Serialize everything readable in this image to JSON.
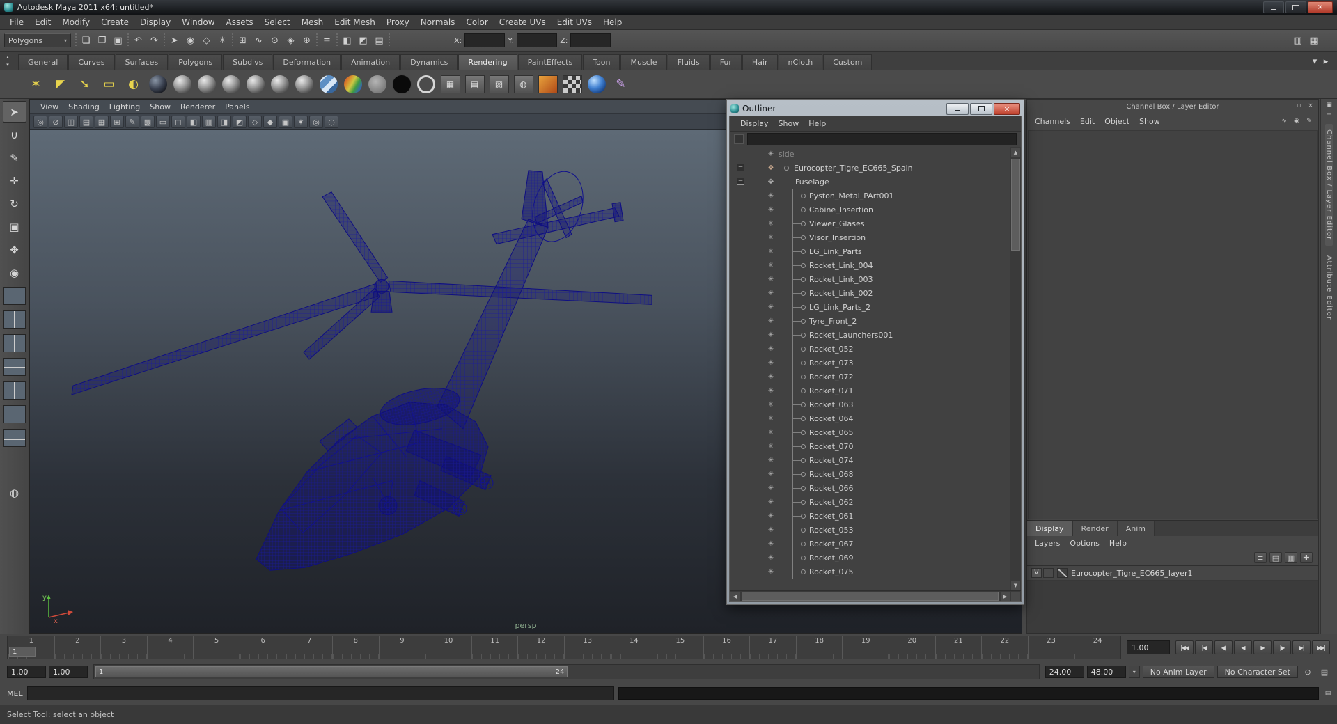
{
  "window": {
    "title": "Autodesk Maya 2011 x64: untitled*"
  },
  "menubar": {
    "items": [
      "File",
      "Edit",
      "Modify",
      "Create",
      "Display",
      "Window",
      "Assets",
      "Select",
      "Mesh",
      "Edit Mesh",
      "Proxy",
      "Normals",
      "Color",
      "Create UVs",
      "Edit UVs",
      "Help"
    ]
  },
  "statusline": {
    "mode": "Polygons",
    "x_label": "X:",
    "y_label": "Y:",
    "z_label": "Z:",
    "items": [
      {
        "name": "separator",
        "sep": true
      },
      {
        "name": "new-scene-icon",
        "glyph": "❏"
      },
      {
        "name": "open-scene-icon",
        "glyph": "❐"
      },
      {
        "name": "save-scene-icon",
        "glyph": "▣"
      },
      {
        "name": "separator",
        "sep": true
      },
      {
        "name": "undo-icon",
        "glyph": "↶"
      },
      {
        "name": "redo-icon",
        "glyph": "↷"
      },
      {
        "name": "separator",
        "sep": true
      },
      {
        "name": "select-hierarchy-icon",
        "glyph": "➤"
      },
      {
        "name": "select-object-icon",
        "glyph": "◉"
      },
      {
        "name": "select-component-icon",
        "glyph": "◇"
      },
      {
        "name": "highlight-selection-icon",
        "glyph": "✳"
      },
      {
        "name": "separator",
        "sep": true
      },
      {
        "name": "snap-to-grid-icon",
        "glyph": "⊞"
      },
      {
        "name": "snap-to-curve-icon",
        "glyph": "∿"
      },
      {
        "name": "snap-to-point-icon",
        "glyph": "⊙"
      },
      {
        "name": "snap-to-plane-icon",
        "glyph": "◈"
      },
      {
        "name": "make-live-icon",
        "glyph": "⊕"
      },
      {
        "name": "separator",
        "sep": true
      },
      {
        "name": "construction-history-icon",
        "glyph": "≡"
      },
      {
        "name": "separator",
        "sep": true
      },
      {
        "name": "render-current-frame-icon",
        "glyph": "◧"
      },
      {
        "name": "ipr-render-icon",
        "glyph": "◩"
      },
      {
        "name": "render-settings-icon",
        "glyph": "▤"
      },
      {
        "name": "separator",
        "sep": true
      }
    ],
    "right_items": [
      {
        "name": "show-channel-box-icon",
        "glyph": "▥"
      },
      {
        "name": "show-layer-editor-icon",
        "glyph": "▦"
      }
    ]
  },
  "shelf": {
    "scroll_icons": [
      {
        "name": "shelf-scroll-up-icon",
        "glyph": "▴"
      },
      {
        "name": "shelf-scroll-down-icon",
        "glyph": "▾"
      }
    ],
    "tabs": [
      {
        "label": "General"
      },
      {
        "label": "Curves"
      },
      {
        "label": "Surfaces"
      },
      {
        "label": "Polygons"
      },
      {
        "label": "Subdivs"
      },
      {
        "label": "Deformation"
      },
      {
        "label": "Animation"
      },
      {
        "label": "Dynamics"
      },
      {
        "label": "Rendering",
        "active": true
      },
      {
        "label": "PaintEffects"
      },
      {
        "label": "Toon"
      },
      {
        "label": "Muscle"
      },
      {
        "label": "Fluids"
      },
      {
        "label": "Fur"
      },
      {
        "label": "Hair"
      },
      {
        "label": "nCloth"
      },
      {
        "label": "Custom"
      }
    ],
    "tab_extra_icons": [
      {
        "name": "shelf-menu-icon",
        "glyph": "▾"
      },
      {
        "name": "shelf-editor-icon",
        "glyph": "▸"
      }
    ],
    "icons": [
      {
        "name": "point-light-icon",
        "kind": "lt",
        "glyph": "✶"
      },
      {
        "name": "spot-light-icon",
        "kind": "lt",
        "glyph": "◤"
      },
      {
        "name": "directional-light-icon",
        "kind": "lt",
        "glyph": "➘"
      },
      {
        "name": "area-light-icon",
        "kind": "lt",
        "glyph": "▭"
      },
      {
        "name": "volume-light-icon",
        "kind": "lt",
        "glyph": "◐"
      },
      {
        "name": "shaded-sphere-icon",
        "kind": "ball-dark"
      },
      {
        "name": "lambert-material-icon",
        "kind": "ball-g"
      },
      {
        "name": "blinn-material-icon",
        "kind": "ball-g"
      },
      {
        "name": "phong-material-icon",
        "kind": "ball-g"
      },
      {
        "name": "phong-e-material-icon",
        "kind": "ball-g"
      },
      {
        "name": "anisotropic-material-icon",
        "kind": "ball-g"
      },
      {
        "name": "layered-shader-icon",
        "kind": "ball-g"
      },
      {
        "name": "ramp-shader-icon",
        "kind": "ball-ramp"
      },
      {
        "name": "shading-map-icon",
        "kind": "ball-rainbow"
      },
      {
        "name": "surface-shader-icon",
        "kind": "ball-flat"
      },
      {
        "name": "use-background-icon",
        "kind": "ball-black"
      },
      {
        "name": "light-ball-icon",
        "kind": "ring"
      },
      {
        "name": "file-texture-icon",
        "kind": "sq",
        "glyph": "▦"
      },
      {
        "name": "place2d-texture-icon",
        "kind": "sq",
        "glyph": "▤"
      },
      {
        "name": "bump-map-icon",
        "kind": "sq",
        "glyph": "▨"
      },
      {
        "name": "env-ball-icon",
        "kind": "sq",
        "glyph": "◍"
      },
      {
        "name": "ramp-texture-icon",
        "kind": "sq-orange"
      },
      {
        "name": "checker-texture-icon",
        "kind": "sq-checker"
      },
      {
        "name": "ocean-shader-icon",
        "kind": "ball-ocean"
      },
      {
        "name": "paint-effects-brush-icon",
        "kind": "brush",
        "glyph": "✎"
      }
    ]
  },
  "toolbox": {
    "tools": [
      {
        "name": "select-tool-button",
        "glyph": "➤",
        "active": true
      },
      {
        "name": "lasso-select-tool-button",
        "glyph": "∪"
      },
      {
        "name": "paint-select-tool-button",
        "glyph": "✎"
      },
      {
        "name": "move-tool-button",
        "glyph": "✛"
      },
      {
        "name": "rotate-tool-button",
        "glyph": "↻"
      },
      {
        "name": "scale-tool-button",
        "glyph": "▣"
      },
      {
        "name": "universal-manipulator-button",
        "glyph": "✥"
      },
      {
        "name": "soft-modification-button",
        "glyph": "◉"
      }
    ],
    "layouts": [
      {
        "name": "layout-single-pane-button",
        "kind": "lay-1"
      },
      {
        "name": "layout-four-pane-button",
        "kind": "lay-4"
      },
      {
        "name": "layout-two-pane-side-button",
        "kind": "lay-2v"
      },
      {
        "name": "layout-two-pane-stacked-button",
        "kind": "lay-2h"
      },
      {
        "name": "layout-three-pane-button",
        "kind": "lay-3"
      },
      {
        "name": "layout-outliner-persp-button",
        "kind": "lay-o"
      },
      {
        "name": "layout-hypershade-persp-button",
        "kind": "lay-h"
      }
    ],
    "extra_tool": {
      "glyph": "◍"
    }
  },
  "viewport": {
    "menus": [
      "View",
      "Shading",
      "Lighting",
      "Show",
      "Renderer",
      "Panels"
    ],
    "toolbar_icons": [
      {
        "name": "select-camera-icon",
        "glyph": "◎"
      },
      {
        "name": "lock-camera-icon",
        "glyph": "⊘"
      },
      {
        "name": "camera-attributes-icon",
        "glyph": "◫"
      },
      {
        "name": "bookmark-icon",
        "glyph": "▤"
      },
      {
        "name": "image-plane-icon",
        "glyph": "▦"
      },
      {
        "name": "two-d-pan-zoom-icon",
        "glyph": "⊞"
      },
      {
        "name": "grease-pencil-icon",
        "glyph": "✎"
      },
      {
        "name": "grid-icon",
        "glyph": "▩"
      },
      {
        "name": "film-gate-icon",
        "glyph": "▭"
      },
      {
        "name": "resolution-gate-icon",
        "glyph": "◻"
      },
      {
        "name": "gate-mask-icon",
        "glyph": "◧"
      },
      {
        "name": "field-chart-icon",
        "glyph": "▥"
      },
      {
        "name": "safe-action-icon",
        "glyph": "◨"
      },
      {
        "name": "safe-title-icon",
        "glyph": "◩"
      },
      {
        "name": "wireframe-mode-icon",
        "glyph": "◇"
      },
      {
        "name": "shaded-mode-icon",
        "glyph": "◆"
      },
      {
        "name": "textured-mode-icon",
        "glyph": "▣"
      },
      {
        "name": "lights-mode-icon",
        "glyph": "✶"
      },
      {
        "name": "isolate-select-icon",
        "glyph": "◎"
      },
      {
        "name": "xray-icon",
        "glyph": "◌"
      }
    ],
    "camera_label": "persp",
    "axis_labels": {
      "x": "x",
      "y": "y"
    }
  },
  "outliner": {
    "title": "Outliner",
    "menus": [
      "Display",
      "Show",
      "Help"
    ],
    "side_label": "side",
    "root_label": "Eurocopter_Tigre_EC665_Spain",
    "group_label": "Fuselage",
    "expand_glyph": "−",
    "node_icon_glyph": "✳",
    "root_icon_glyph": "❖",
    "group_icon_glyph": "✥",
    "side_icon_glyph": "✳",
    "children": [
      "Pyston_Metal_PArt001",
      "Cabine_Insertion",
      "Viewer_Glases",
      "Visor_Insertion",
      "LG_Link_Parts",
      "Rocket_Link_004",
      "Rocket_Link_003",
      "Rocket_Link_002",
      "LG_Link_Parts_2",
      "Tyre_Front_2",
      "Rocket_Launchers001",
      "Rocket_052",
      "Rocket_073",
      "Rocket_072",
      "Rocket_071",
      "Rocket_063",
      "Rocket_064",
      "Rocket_065",
      "Rocket_070",
      "Rocket_074",
      "Rocket_068",
      "Rocket_066",
      "Rocket_062",
      "Rocket_061",
      "Rocket_053",
      "Rocket_067",
      "Rocket_069",
      "Rocket_075"
    ]
  },
  "channel_box": {
    "strip_title": "Channel Box / Layer Editor",
    "strip_icons": [
      {
        "name": "panel-menu-icon",
        "glyph": "▫"
      },
      {
        "name": "panel-close-icon",
        "glyph": "×"
      }
    ],
    "menus": [
      "Channels",
      "Edit",
      "Object",
      "Show"
    ],
    "menu_icons": [
      {
        "name": "channel-slider-speed-icon",
        "glyph": "∿"
      },
      {
        "name": "channel-slider-mode-icon",
        "glyph": "◉"
      },
      {
        "name": "channel-settings-icon",
        "glyph": "✎"
      }
    ],
    "layer_tabs": [
      {
        "label": "Display",
        "active": true
      },
      {
        "label": "Render"
      },
      {
        "label": "Anim"
      }
    ],
    "layer_menus": [
      "Layers",
      "Options",
      "Help"
    ],
    "layer_toolbar_icons": [
      {
        "name": "sort-layers-icon",
        "glyph": "≡"
      },
      {
        "name": "empty-layer-icon",
        "glyph": "▤"
      },
      {
        "name": "new-layer-icon",
        "glyph": "▥"
      },
      {
        "name": "new-layer-from-selected-icon",
        "glyph": "✚"
      }
    ],
    "layers": [
      {
        "visibility": "V",
        "name_label": "Eurocopter_Tigre_EC665_layer1"
      }
    ]
  },
  "side_strip": {
    "icons": [
      {
        "name": "panel-expand-icon",
        "glyph": "▣"
      },
      {
        "name": "panel-collapse-icon",
        "glyph": "─"
      }
    ],
    "tabs": [
      {
        "label": "Channel Box / Layer Editor",
        "active": true
      },
      {
        "label": "Attribute Editor"
      }
    ]
  },
  "timeline": {
    "ticks": [
      "1",
      "2",
      "3",
      "4",
      "5",
      "6",
      "7",
      "8",
      "9",
      "10",
      "11",
      "12",
      "13",
      "14",
      "15",
      "16",
      "17",
      "18",
      "19",
      "20",
      "21",
      "22",
      "23",
      "24"
    ],
    "current_frame": "1",
    "current_time": "1.00",
    "transport": [
      {
        "name": "go-to-start-button",
        "glyph": "|◀◀"
      },
      {
        "name": "step-back-frame-button",
        "glyph": "|◀"
      },
      {
        "name": "step-back-key-button",
        "glyph": "◀|"
      },
      {
        "name": "play-backwards-button",
        "glyph": "◀"
      },
      {
        "name": "play-forwards-button",
        "glyph": "▶"
      },
      {
        "name": "step-forward-key-button",
        "glyph": "|▶"
      },
      {
        "name": "step-forward-frame-button",
        "glyph": "▶|"
      },
      {
        "name": "go-to-end-button",
        "glyph": "▶▶|"
      }
    ]
  },
  "range_slider": {
    "anim_start": "1.00",
    "play_start": "1.00",
    "thumb_start_label": "1",
    "thumb_end_label": "24",
    "play_end": "24.00",
    "anim_end": "48.00",
    "menu_wedge_glyph": "▾",
    "anim_layer": "No Anim Layer",
    "character_set": "No Character Set",
    "icons": [
      {
        "name": "auto-keyframe-icon",
        "glyph": "⊙"
      },
      {
        "name": "animation-preferences-icon",
        "glyph": "▤"
      }
    ]
  },
  "command_line": {
    "label": "MEL"
  },
  "help_line": {
    "text": "Select Tool: select an object"
  },
  "colors": {
    "wireframe_blue": "#15158c",
    "viewport_top": "#5e6a76",
    "viewport_bottom": "#1f2228",
    "close_button_red": "#c0432f",
    "camera_label_green": "#8faf8f"
  }
}
